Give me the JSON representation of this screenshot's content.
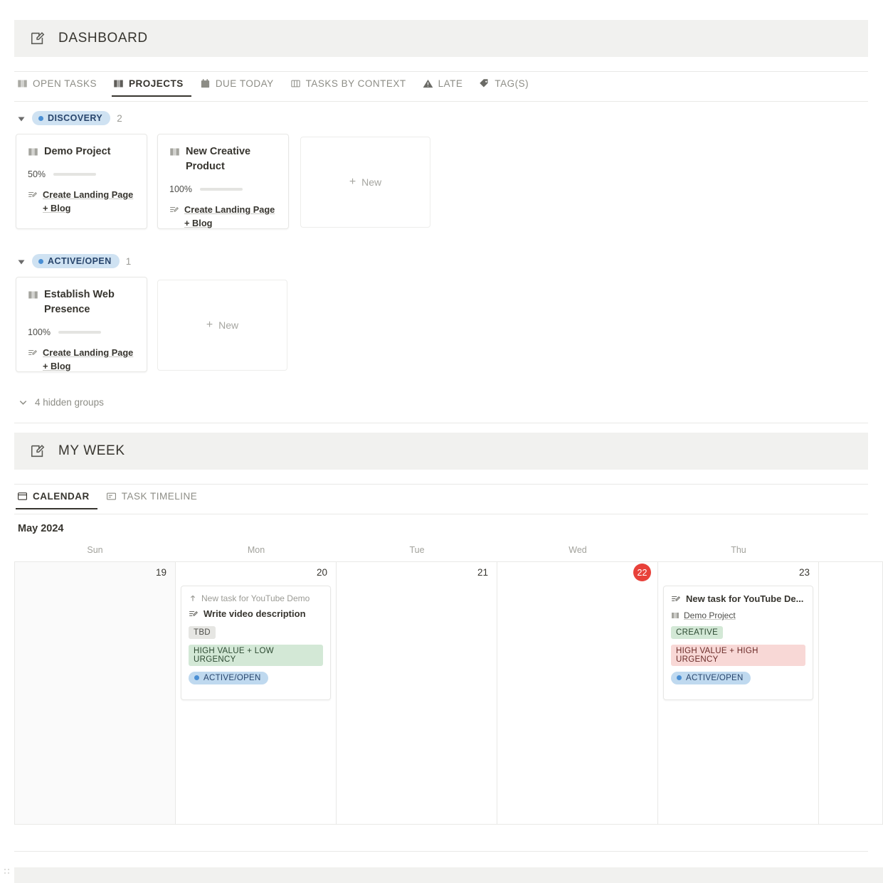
{
  "sections": [
    {
      "title": "DASHBOARD",
      "icon": "note-edit-icon"
    },
    {
      "title": "MY WEEK",
      "icon": "note-edit-icon"
    }
  ],
  "dashboard": {
    "tabs": [
      {
        "label": "OPEN TASKS",
        "icon": "book-icon",
        "active": false
      },
      {
        "label": "PROJECTS",
        "icon": "book-icon",
        "active": true
      },
      {
        "label": "DUE TODAY",
        "icon": "calendar-icon",
        "active": false
      },
      {
        "label": "TASKS BY CONTEXT",
        "icon": "columns-icon",
        "active": false
      },
      {
        "label": "LATE",
        "icon": "warning-icon",
        "active": false
      },
      {
        "label": "TAG(S)",
        "icon": "tag-icon",
        "active": false
      }
    ],
    "groups": [
      {
        "status": "DISCOVERY",
        "count": "2",
        "cards": [
          {
            "title": "Demo Project",
            "icon": "book-icon",
            "progress_label": "50%",
            "progress_value": 50,
            "task_link": "Create Landing Page + Blog",
            "task_icon": "task-edit-icon"
          },
          {
            "title": "New Creative Product",
            "icon": "book-icon",
            "progress_label": "100%",
            "progress_value": 100,
            "task_link": "Create Landing Page + Blog",
            "task_icon": "task-edit-icon"
          }
        ],
        "new_label": "New"
      },
      {
        "status": "ACTIVE/OPEN",
        "count": "1",
        "cards": [
          {
            "title": "Establish Web Presence",
            "icon": "book-icon",
            "progress_label": "100%",
            "progress_value": 100,
            "task_link": "Create Landing Page + Blog",
            "task_icon": "task-edit-icon"
          }
        ],
        "new_label": "New"
      }
    ],
    "hidden_groups_label": "4 hidden groups"
  },
  "my_week": {
    "tabs": [
      {
        "label": "CALENDAR",
        "icon": "calendar-view-icon",
        "active": true
      },
      {
        "label": "TASK TIMELINE",
        "icon": "timeline-icon",
        "active": false
      }
    ],
    "calendar": {
      "month": "May 2024",
      "day_headers": [
        "Sun",
        "Mon",
        "Tue",
        "Wed",
        "Thu"
      ],
      "days": [
        {
          "number": "19",
          "today": false,
          "past": true,
          "events": []
        },
        {
          "number": "20",
          "today": false,
          "past": false,
          "events": [
            {
              "parent": "New task for YouTube Demo",
              "parent_icon": "arrow-up-icon",
              "title": "Write video description",
              "title_icon": "task-edit-icon",
              "chips": [
                {
                  "label": "TBD",
                  "style": "gray"
                },
                {
                  "label": "HIGH VALUE + LOW URGENCY",
                  "style": "green"
                },
                {
                  "label": "ACTIVE/OPEN",
                  "style": "blue"
                }
              ]
            }
          ]
        },
        {
          "number": "21",
          "today": false,
          "past": false,
          "events": []
        },
        {
          "number": "22",
          "today": true,
          "past": false,
          "events": []
        },
        {
          "number": "23",
          "today": false,
          "past": false,
          "events": [
            {
              "title": "New task for YouTube De...",
              "title_icon": "task-edit-icon",
              "project": "Demo Project",
              "project_icon": "book-icon",
              "chips": [
                {
                  "label": "CREATIVE",
                  "style": "green"
                },
                {
                  "label": "HIGH VALUE + HIGH URGENCY",
                  "style": "red"
                },
                {
                  "label": "ACTIVE/OPEN",
                  "style": "blue"
                }
              ]
            }
          ]
        },
        {
          "number": "",
          "today": false,
          "past": false,
          "events": []
        }
      ]
    }
  },
  "colors": {
    "accent_green": "#6b8f6f",
    "today_red": "#e8413a",
    "status_blue": "#4a8fd4",
    "banner_bg": "#f1f1ef"
  }
}
